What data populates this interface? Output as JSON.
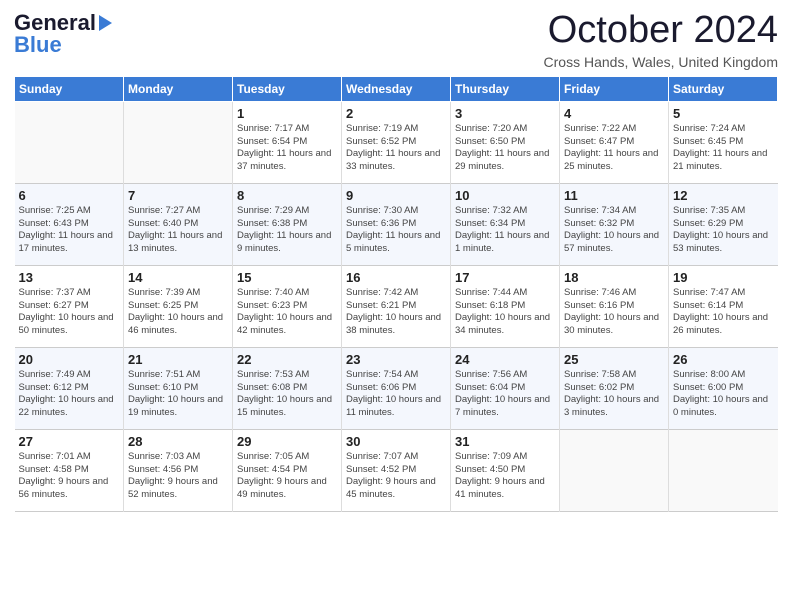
{
  "logo": {
    "line1": "General",
    "line2": "Blue",
    "arrow": "▶"
  },
  "title": "October 2024",
  "location": "Cross Hands, Wales, United Kingdom",
  "days_of_week": [
    "Sunday",
    "Monday",
    "Tuesday",
    "Wednesday",
    "Thursday",
    "Friday",
    "Saturday"
  ],
  "weeks": [
    [
      {
        "day": "",
        "text": ""
      },
      {
        "day": "",
        "text": ""
      },
      {
        "day": "1",
        "text": "Sunrise: 7:17 AM\nSunset: 6:54 PM\nDaylight: 11 hours and 37 minutes."
      },
      {
        "day": "2",
        "text": "Sunrise: 7:19 AM\nSunset: 6:52 PM\nDaylight: 11 hours and 33 minutes."
      },
      {
        "day": "3",
        "text": "Sunrise: 7:20 AM\nSunset: 6:50 PM\nDaylight: 11 hours and 29 minutes."
      },
      {
        "day": "4",
        "text": "Sunrise: 7:22 AM\nSunset: 6:47 PM\nDaylight: 11 hours and 25 minutes."
      },
      {
        "day": "5",
        "text": "Sunrise: 7:24 AM\nSunset: 6:45 PM\nDaylight: 11 hours and 21 minutes."
      }
    ],
    [
      {
        "day": "6",
        "text": "Sunrise: 7:25 AM\nSunset: 6:43 PM\nDaylight: 11 hours and 17 minutes."
      },
      {
        "day": "7",
        "text": "Sunrise: 7:27 AM\nSunset: 6:40 PM\nDaylight: 11 hours and 13 minutes."
      },
      {
        "day": "8",
        "text": "Sunrise: 7:29 AM\nSunset: 6:38 PM\nDaylight: 11 hours and 9 minutes."
      },
      {
        "day": "9",
        "text": "Sunrise: 7:30 AM\nSunset: 6:36 PM\nDaylight: 11 hours and 5 minutes."
      },
      {
        "day": "10",
        "text": "Sunrise: 7:32 AM\nSunset: 6:34 PM\nDaylight: 11 hours and 1 minute."
      },
      {
        "day": "11",
        "text": "Sunrise: 7:34 AM\nSunset: 6:32 PM\nDaylight: 10 hours and 57 minutes."
      },
      {
        "day": "12",
        "text": "Sunrise: 7:35 AM\nSunset: 6:29 PM\nDaylight: 10 hours and 53 minutes."
      }
    ],
    [
      {
        "day": "13",
        "text": "Sunrise: 7:37 AM\nSunset: 6:27 PM\nDaylight: 10 hours and 50 minutes."
      },
      {
        "day": "14",
        "text": "Sunrise: 7:39 AM\nSunset: 6:25 PM\nDaylight: 10 hours and 46 minutes."
      },
      {
        "day": "15",
        "text": "Sunrise: 7:40 AM\nSunset: 6:23 PM\nDaylight: 10 hours and 42 minutes."
      },
      {
        "day": "16",
        "text": "Sunrise: 7:42 AM\nSunset: 6:21 PM\nDaylight: 10 hours and 38 minutes."
      },
      {
        "day": "17",
        "text": "Sunrise: 7:44 AM\nSunset: 6:18 PM\nDaylight: 10 hours and 34 minutes."
      },
      {
        "day": "18",
        "text": "Sunrise: 7:46 AM\nSunset: 6:16 PM\nDaylight: 10 hours and 30 minutes."
      },
      {
        "day": "19",
        "text": "Sunrise: 7:47 AM\nSunset: 6:14 PM\nDaylight: 10 hours and 26 minutes."
      }
    ],
    [
      {
        "day": "20",
        "text": "Sunrise: 7:49 AM\nSunset: 6:12 PM\nDaylight: 10 hours and 22 minutes."
      },
      {
        "day": "21",
        "text": "Sunrise: 7:51 AM\nSunset: 6:10 PM\nDaylight: 10 hours and 19 minutes."
      },
      {
        "day": "22",
        "text": "Sunrise: 7:53 AM\nSunset: 6:08 PM\nDaylight: 10 hours and 15 minutes."
      },
      {
        "day": "23",
        "text": "Sunrise: 7:54 AM\nSunset: 6:06 PM\nDaylight: 10 hours and 11 minutes."
      },
      {
        "day": "24",
        "text": "Sunrise: 7:56 AM\nSunset: 6:04 PM\nDaylight: 10 hours and 7 minutes."
      },
      {
        "day": "25",
        "text": "Sunrise: 7:58 AM\nSunset: 6:02 PM\nDaylight: 10 hours and 3 minutes."
      },
      {
        "day": "26",
        "text": "Sunrise: 8:00 AM\nSunset: 6:00 PM\nDaylight: 10 hours and 0 minutes."
      }
    ],
    [
      {
        "day": "27",
        "text": "Sunrise: 7:01 AM\nSunset: 4:58 PM\nDaylight: 9 hours and 56 minutes."
      },
      {
        "day": "28",
        "text": "Sunrise: 7:03 AM\nSunset: 4:56 PM\nDaylight: 9 hours and 52 minutes."
      },
      {
        "day": "29",
        "text": "Sunrise: 7:05 AM\nSunset: 4:54 PM\nDaylight: 9 hours and 49 minutes."
      },
      {
        "day": "30",
        "text": "Sunrise: 7:07 AM\nSunset: 4:52 PM\nDaylight: 9 hours and 45 minutes."
      },
      {
        "day": "31",
        "text": "Sunrise: 7:09 AM\nSunset: 4:50 PM\nDaylight: 9 hours and 41 minutes."
      },
      {
        "day": "",
        "text": ""
      },
      {
        "day": "",
        "text": ""
      }
    ]
  ]
}
